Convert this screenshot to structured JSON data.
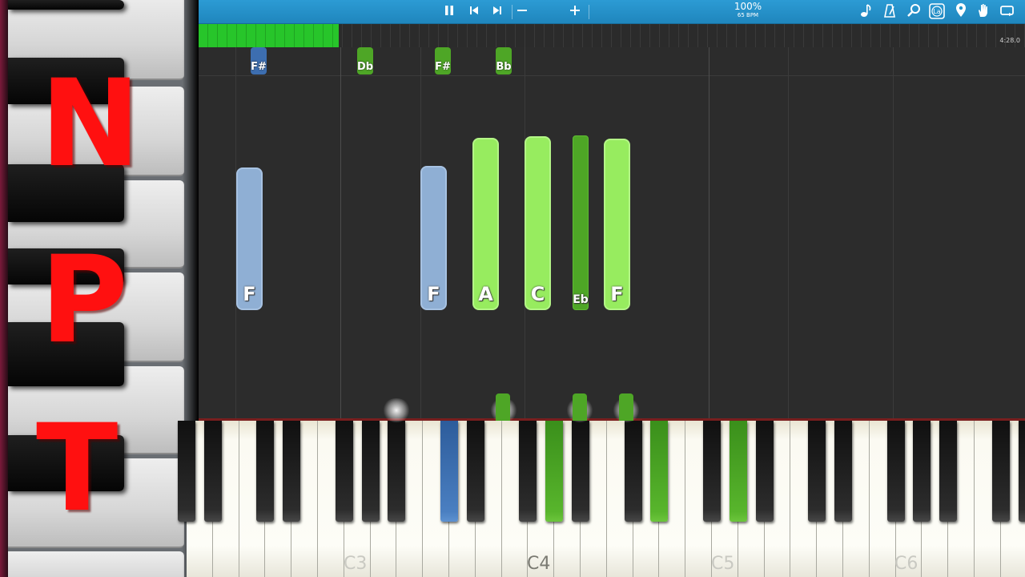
{
  "brand": {
    "letters": [
      "N",
      "P",
      "T"
    ],
    "color": "#ff1010"
  },
  "toolbar": {
    "tempo_percent": "100%",
    "tempo_bpm": "65 BPM",
    "icons": [
      "pause-icon",
      "skip-back-icon",
      "skip-forward-icon",
      "minus-icon",
      "plus-icon",
      "note-icon",
      "metronome-icon",
      "magnifier-icon",
      "label-icon",
      "location-pin-icon",
      "hand-icon",
      "loop-icon"
    ],
    "label_icon_text": "La"
  },
  "progress": {
    "fraction_complete": 0.17,
    "time": "4:28.0"
  },
  "notes": {
    "upcoming_sharps": [
      "F#",
      "Db",
      "F#",
      "Bb"
    ],
    "falling": [
      "F",
      "F",
      "A",
      "C",
      "Eb",
      "F"
    ]
  },
  "keyboard": {
    "octave_labels": [
      "C3",
      "C4",
      "C5",
      "C6"
    ],
    "active_keys": [
      "blue",
      "green",
      "green",
      "green"
    ]
  },
  "colors": {
    "left_hand": "#8fafd4",
    "right_hand": "#97ec5f",
    "right_hand_black": "#4ea626",
    "toolbar": "#2293c9",
    "progress": "#27c52a"
  }
}
